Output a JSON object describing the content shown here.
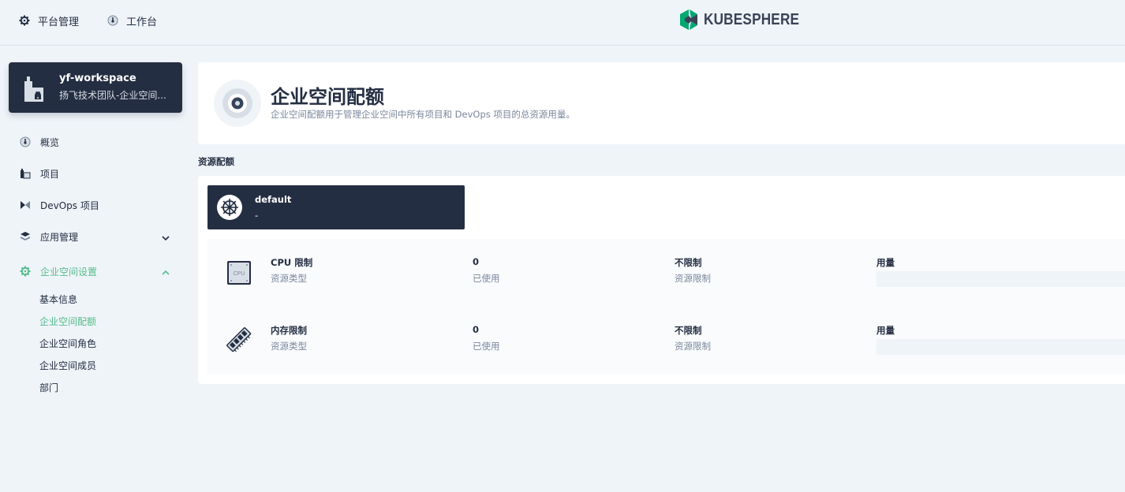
{
  "topnav": {
    "platform_label": "平台管理",
    "workbench_label": "工作台",
    "brand": "KUBESPHERE"
  },
  "workspace": {
    "name": "yf-workspace",
    "description": "扬飞技术团队-企业空间..."
  },
  "sidebar": {
    "items": [
      {
        "label": "概览",
        "icon": "dashboard-icon"
      },
      {
        "label": "项目",
        "icon": "project-icon"
      },
      {
        "label": "DevOps 项目",
        "icon": "devops-icon"
      },
      {
        "label": "应用管理",
        "icon": "layers-icon",
        "expanded": false
      },
      {
        "label": "企业空间设置",
        "icon": "gear-icon",
        "expanded": true,
        "active": true
      }
    ],
    "subitems": [
      {
        "label": "基本信息"
      },
      {
        "label": "企业空间配额",
        "active": true
      },
      {
        "label": "企业空间角色"
      },
      {
        "label": "企业空间成员"
      },
      {
        "label": "部门"
      }
    ]
  },
  "banner": {
    "title": "企业空间配额",
    "description": "企业空间配额用于管理企业空间中所有项目和 DevOps 项目的总资源用量。"
  },
  "section_label": "资源配额",
  "quota": {
    "name": "default",
    "description": "-",
    "rows": [
      {
        "icon": "cpu-icon",
        "icon_text": "CPU",
        "resource": "CPU 限制",
        "resource_label": "资源类型",
        "used": "0",
        "used_label": "已使用",
        "limit": "不限制",
        "limit_label": "资源限制",
        "usage_label": "用量",
        "usage_fraction": 0
      },
      {
        "icon": "memory-icon",
        "resource": "内存限制",
        "resource_label": "资源类型",
        "used": "0",
        "used_label": "已使用",
        "limit": "不限制",
        "limit_label": "资源限制",
        "usage_label": "用量",
        "usage_fraction": 0
      }
    ]
  },
  "colors": {
    "accent": "#55bc8a",
    "dark": "#242e42",
    "muted": "#79879c",
    "background": "#eff4f9"
  }
}
